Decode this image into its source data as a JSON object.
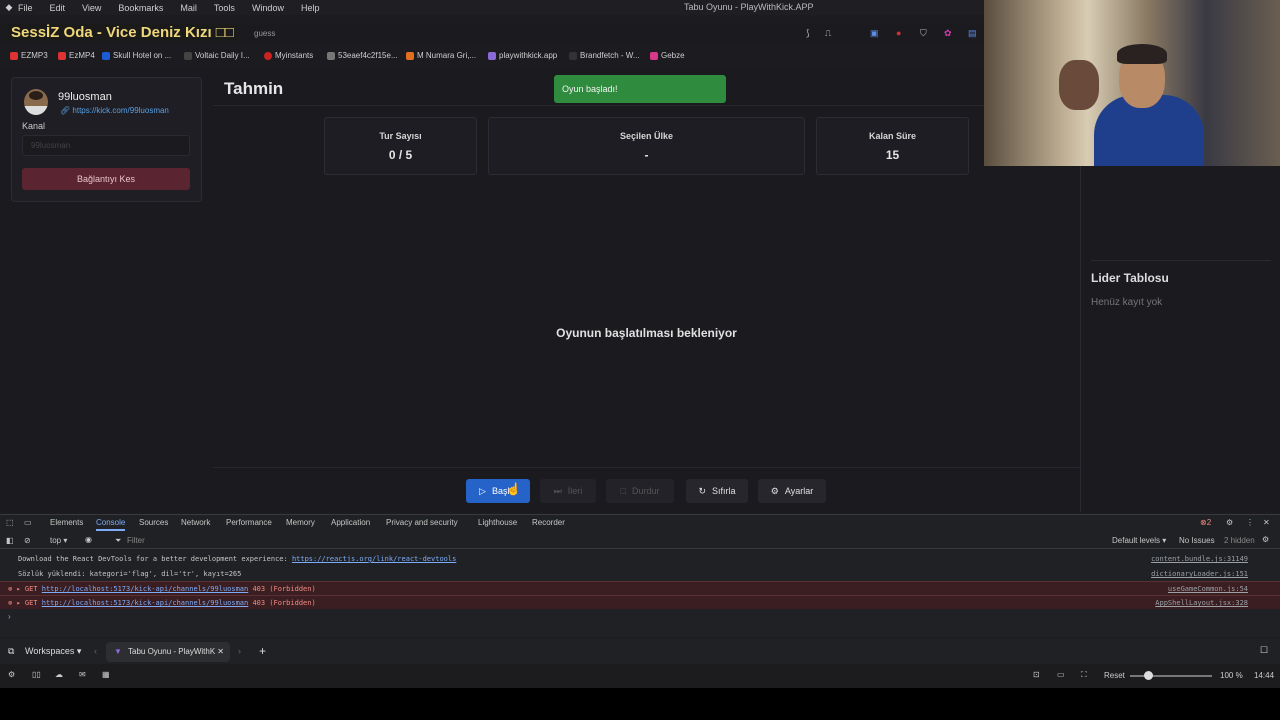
{
  "os_menu": {
    "items": [
      "File",
      "Edit",
      "View",
      "Bookmarks",
      "Mail",
      "Tools",
      "Window",
      "Help"
    ],
    "window_title": "Tabu Oyunu - PlayWithKick.APP"
  },
  "overlay_title": "SessİZ Oda - Vice Deniz Kızı □□",
  "address": {
    "partial_text": "guess"
  },
  "bookmarks": [
    {
      "label": "EZMP3",
      "color": "#d33"
    },
    {
      "label": "EzMP4",
      "color": "#d33"
    },
    {
      "label": "Skull Hotel on ...",
      "color": "#1b5bd6"
    },
    {
      "label": "Voltaic Daily I...",
      "color": "#222"
    },
    {
      "label": "Myinstants",
      "color": "#c22"
    },
    {
      "label": "53eaef4c2f15e...",
      "color": "#777"
    },
    {
      "label": "M Numara Gri,...",
      "color": "#e07020"
    },
    {
      "label": "playwithkick.app",
      "color": "#8a6ad8"
    },
    {
      "label": "Brandfetch - W...",
      "color": "#222"
    },
    {
      "label": "Gebze",
      "color": "#d6388a"
    }
  ],
  "sidebar": {
    "username": "99luosman",
    "link": "https://kick.com/99luosman",
    "channel_label": "Kanal",
    "channel_placeholder": "99luosman",
    "disconnect_label": "Bağlantıyı Kes"
  },
  "main": {
    "title": "Tahmin",
    "toast": "Oyun başladı!",
    "stats": [
      {
        "label": "Tur Sayısı",
        "value": "0 / 5"
      },
      {
        "label": "Seçilen Ülke",
        "value": "-"
      },
      {
        "label": "Kalan Süre",
        "value": "15"
      }
    ],
    "waiting_text": "Oyunun başlatılması bekleniyor"
  },
  "leaderboard": {
    "title": "Lider Tablosu",
    "empty_text": "Henüz kayıt yok"
  },
  "controls": {
    "start": "Başlat",
    "next": "İleri",
    "stop": "Durdur",
    "reset": "Sıfırla",
    "settings": "Ayarlar"
  },
  "devtools": {
    "tabs": [
      "Elements",
      "Console",
      "Sources",
      "Network",
      "Performance",
      "Memory",
      "Application",
      "Privacy and security",
      "Lighthouse",
      "Recorder"
    ],
    "active_tab": "Console",
    "error_count": "2",
    "context": "top",
    "filter_placeholder": "Filter",
    "levels": "Default levels",
    "issues": "No Issues",
    "hidden": "2 hidden",
    "logs": [
      {
        "type": "info",
        "text": "Download the React DevTools for a better development experience: ",
        "link": "https://reactjs.org/link/react-devtools",
        "source": "content.bundle.js:31149"
      },
      {
        "type": "info",
        "text": "Sözlük yüklendi: kategori='flag', dil='tr', kayıt=265",
        "link": "",
        "source": "dictionaryLoader.js:151"
      },
      {
        "type": "error",
        "text": "▸ GET ",
        "link": "http://localhost:5173/kick-api/channels/99luosman",
        "suffix": " 403 (Forbidden)",
        "source": "useGameCommon.js:54"
      },
      {
        "type": "error",
        "text": "▸ GET ",
        "link": "http://localhost:5173/kick-api/channels/99luosman",
        "suffix": " 403 (Forbidden)",
        "source": "AppShellLayout.jsx:328"
      }
    ]
  },
  "taskbar": {
    "workspaces": "Workspaces",
    "tab_title": "Tabu Oyunu - PlayWithK",
    "reset": "Reset",
    "zoom": "100 %",
    "time": "14:44"
  }
}
